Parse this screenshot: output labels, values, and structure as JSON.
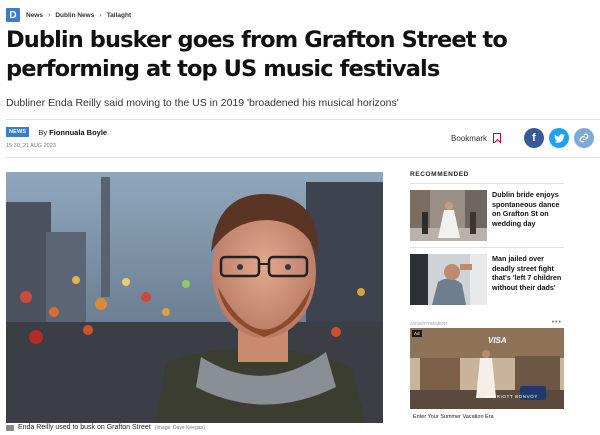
{
  "site": {
    "logo_letter": "D"
  },
  "breadcrumb": [
    "News",
    "Dublin News",
    "Tallaght"
  ],
  "article": {
    "headline": "Dublin busker goes from Grafton Street to performing at top US music festivals",
    "standfirst": "Dubliner Enda Reilly said moving to the US in 2019 'broadened his musical horizons'",
    "badge": "NEWS",
    "by_prefix": "By",
    "author": "Fionnuala Boyle",
    "timestamp": "15:30, 21 AUG 2023",
    "bookmark_label": "Bookmark",
    "hero_caption": "Enda Reilly used to busk on Grafton Street",
    "hero_credit": "(Image: Dave Keegan)"
  },
  "social": {
    "facebook": "f",
    "twitter": "t",
    "link": "🔗"
  },
  "recommended": {
    "title": "RECOMMENDED",
    "items": [
      {
        "text": "Dublin bride enjoys spontaneous dance on Grafton St on wedding day"
      },
      {
        "text": "Man jailed over deadly street fight that's 'left 7 children without their dads'"
      }
    ]
  },
  "ad": {
    "label": "ADVERTISEMENT",
    "tag": "Ad",
    "brand": "VISA",
    "partner": "MARRIOTT BONVOY",
    "footer": "Enter Your Summer Vacation Era"
  },
  "colors": {
    "brand_blue": "#3a7dc9",
    "bookmark_red": "#c3002f",
    "facebook": "#3b5998",
    "twitter": "#1da1f2"
  }
}
